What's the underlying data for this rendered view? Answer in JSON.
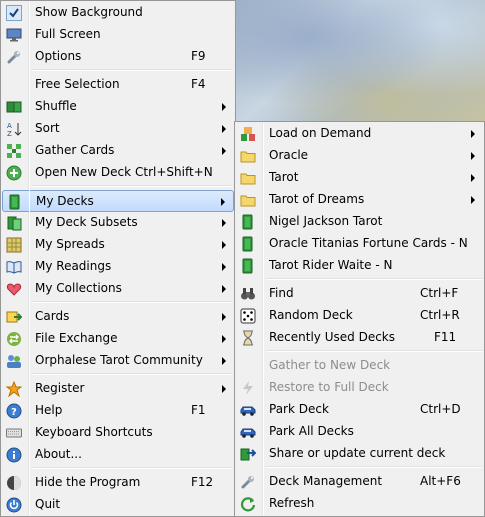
{
  "main_menu": {
    "items": [
      {
        "label": "Show Background",
        "shortcut": "",
        "sub": false,
        "icon": "check-icon"
      },
      {
        "label": "Full Screen",
        "shortcut": "",
        "sub": false,
        "icon": "monitor-icon"
      },
      {
        "label": "Options",
        "shortcut": "F9",
        "sub": false,
        "icon": "wrench-icon"
      },
      {
        "label": "Free Selection",
        "shortcut": "F4",
        "sub": false,
        "icon": ""
      },
      {
        "label": "Shuffle",
        "shortcut": "",
        "sub": true,
        "icon": "shuffle-icon"
      },
      {
        "label": "Sort",
        "shortcut": "",
        "sub": true,
        "icon": "sort-az-icon"
      },
      {
        "label": "Gather Cards",
        "shortcut": "",
        "sub": true,
        "icon": "gather-icon"
      },
      {
        "label": "Open New Deck",
        "shortcut": "Ctrl+Shift+N",
        "sub": false,
        "icon": "add-icon"
      },
      {
        "label": "My Decks",
        "shortcut": "",
        "sub": true,
        "icon": "deck-icon"
      },
      {
        "label": "My Deck Subsets",
        "shortcut": "",
        "sub": true,
        "icon": "subset-icon"
      },
      {
        "label": "My Spreads",
        "shortcut": "",
        "sub": true,
        "icon": "spread-grid-icon"
      },
      {
        "label": "My Readings",
        "shortcut": "",
        "sub": true,
        "icon": "book-icon"
      },
      {
        "label": "My Collections",
        "shortcut": "",
        "sub": true,
        "icon": "heart-icon"
      },
      {
        "label": "Cards",
        "shortcut": "",
        "sub": true,
        "icon": "cards-arrow-icon"
      },
      {
        "label": "File Exchange",
        "shortcut": "",
        "sub": true,
        "icon": "exchange-icon"
      },
      {
        "label": "Orphalese Tarot Community",
        "shortcut": "",
        "sub": true,
        "icon": "community-icon"
      },
      {
        "label": "Register",
        "shortcut": "",
        "sub": true,
        "icon": "star-icon"
      },
      {
        "label": "Help",
        "shortcut": "F1",
        "sub": false,
        "icon": "help-icon"
      },
      {
        "label": "Keyboard Shortcuts",
        "shortcut": "",
        "sub": false,
        "icon": "keyboard-icon"
      },
      {
        "label": "About...",
        "shortcut": "",
        "sub": false,
        "icon": "info-icon"
      },
      {
        "label": "Hide the Program",
        "shortcut": "F12",
        "sub": false,
        "icon": "hide-icon"
      },
      {
        "label": "Quit",
        "shortcut": "",
        "sub": false,
        "icon": "power-icon"
      }
    ]
  },
  "decks_menu": {
    "items": [
      {
        "label": "Load on Demand",
        "shortcut": "",
        "sub": true,
        "icon": "load-icon",
        "disabled": false
      },
      {
        "label": "Oracle",
        "shortcut": "",
        "sub": true,
        "icon": "folder-icon",
        "disabled": false
      },
      {
        "label": "Tarot",
        "shortcut": "",
        "sub": true,
        "icon": "folder-icon",
        "disabled": false
      },
      {
        "label": "Tarot of Dreams",
        "shortcut": "",
        "sub": true,
        "icon": "folder-icon",
        "disabled": false
      },
      {
        "label": "Nigel Jackson Tarot",
        "shortcut": "",
        "sub": false,
        "icon": "deck-icon",
        "disabled": false
      },
      {
        "label": "Oracle Titanias Fortune Cards - N",
        "shortcut": "",
        "sub": false,
        "icon": "deck-icon",
        "disabled": false
      },
      {
        "label": "Tarot Rider Waite - N",
        "shortcut": "",
        "sub": false,
        "icon": "deck-icon",
        "disabled": false
      },
      {
        "label": "Find",
        "shortcut": "Ctrl+F",
        "sub": false,
        "icon": "binoculars-icon",
        "disabled": false
      },
      {
        "label": "Random Deck",
        "shortcut": "Ctrl+R",
        "sub": false,
        "icon": "dice-icon",
        "disabled": false
      },
      {
        "label": "Recently Used Decks",
        "shortcut": "F11",
        "sub": false,
        "icon": "hourglass-icon",
        "disabled": false
      },
      {
        "label": "Gather to New Deck",
        "shortcut": "",
        "sub": false,
        "icon": "",
        "disabled": true
      },
      {
        "label": "Restore to Full Deck",
        "shortcut": "",
        "sub": false,
        "icon": "lightning-icon",
        "disabled": true
      },
      {
        "label": "Park Deck",
        "shortcut": "Ctrl+D",
        "sub": false,
        "icon": "car-icon",
        "disabled": false
      },
      {
        "label": "Park All Decks",
        "shortcut": "",
        "sub": false,
        "icon": "car-icon",
        "disabled": false
      },
      {
        "label": "Share or update current deck",
        "shortcut": "",
        "sub": false,
        "icon": "share-icon",
        "disabled": false
      },
      {
        "label": "Deck Management",
        "shortcut": "Alt+F6",
        "sub": false,
        "icon": "wrench-icon",
        "disabled": false
      },
      {
        "label": "Refresh",
        "shortcut": "",
        "sub": false,
        "icon": "refresh-icon",
        "disabled": false
      }
    ]
  }
}
